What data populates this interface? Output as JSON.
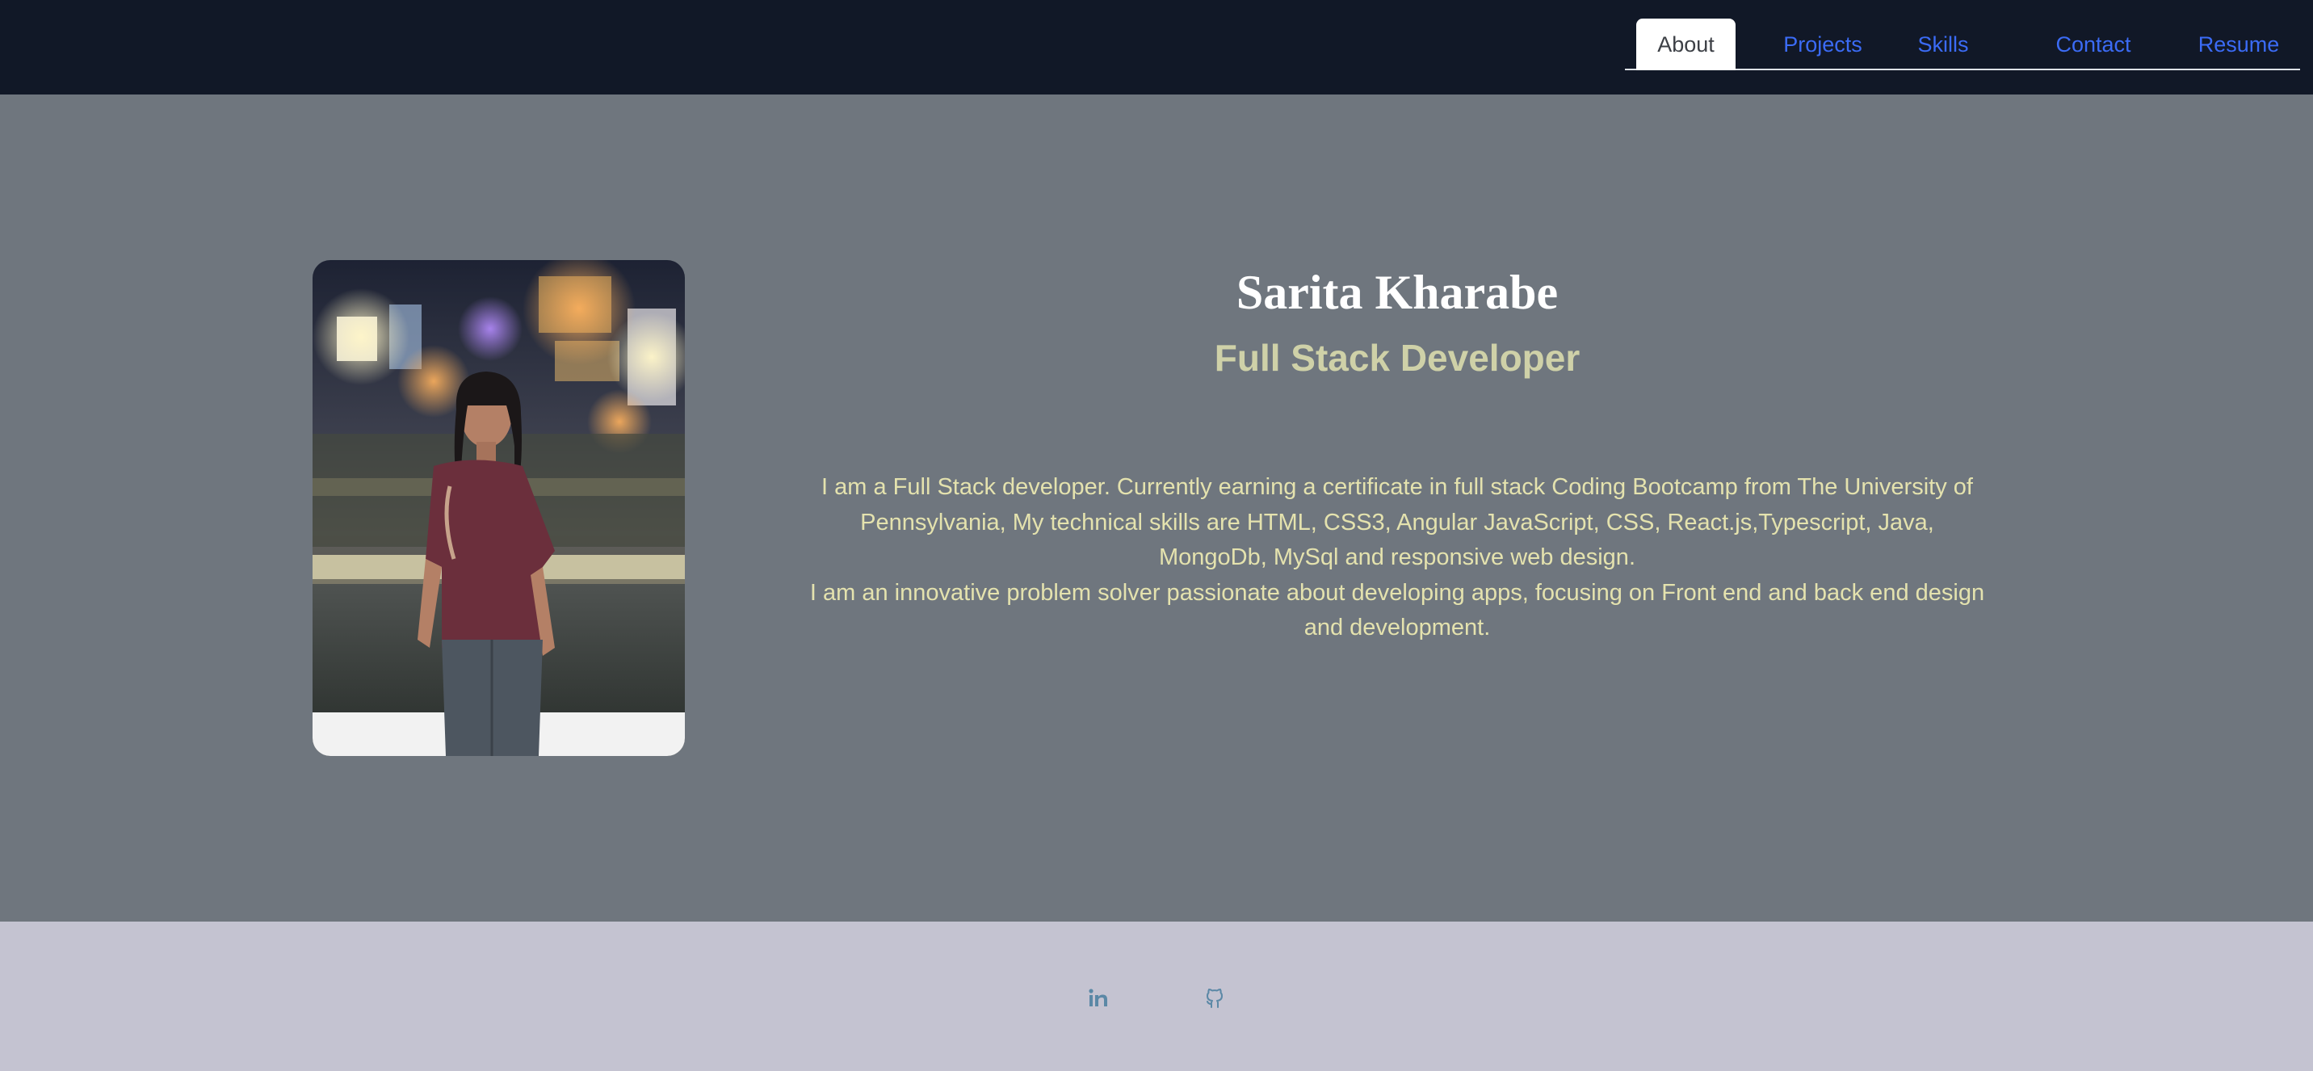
{
  "nav": {
    "tabs": [
      {
        "label": "About",
        "active": true
      },
      {
        "label": "Projects",
        "active": false
      },
      {
        "label": "Skills",
        "active": false
      },
      {
        "label": "Contact",
        "active": false
      },
      {
        "label": "Resume",
        "active": false
      }
    ]
  },
  "about": {
    "name": "Sarita Kharabe",
    "title": "Full Stack Developer",
    "bio": [
      "I am a Full Stack developer. Currently earning a certificate in full stack Coding Bootcamp from The University of Pennsylvania, My technical skills are HTML, CSS3, Angular JavaScript, CSS, React.js,Typescript, Java, MongoDb, MySql and responsive web design.",
      "I am an innovative problem solver passionate about developing apps, focusing on Front end and back end design and development."
    ]
  },
  "footer": {
    "links": [
      {
        "icon": "linkedin-icon"
      },
      {
        "icon": "github-icon"
      }
    ]
  },
  "colors": {
    "navbar_bg": "#111827",
    "hero_bg": "#6f767e",
    "footer_bg": "#c4c3d1",
    "link": "#3b6bf5",
    "name_text": "#ffffff",
    "title_text": "#cfd1a8",
    "bio_text": "#e4e2ae",
    "icon": "#5b88a6"
  }
}
